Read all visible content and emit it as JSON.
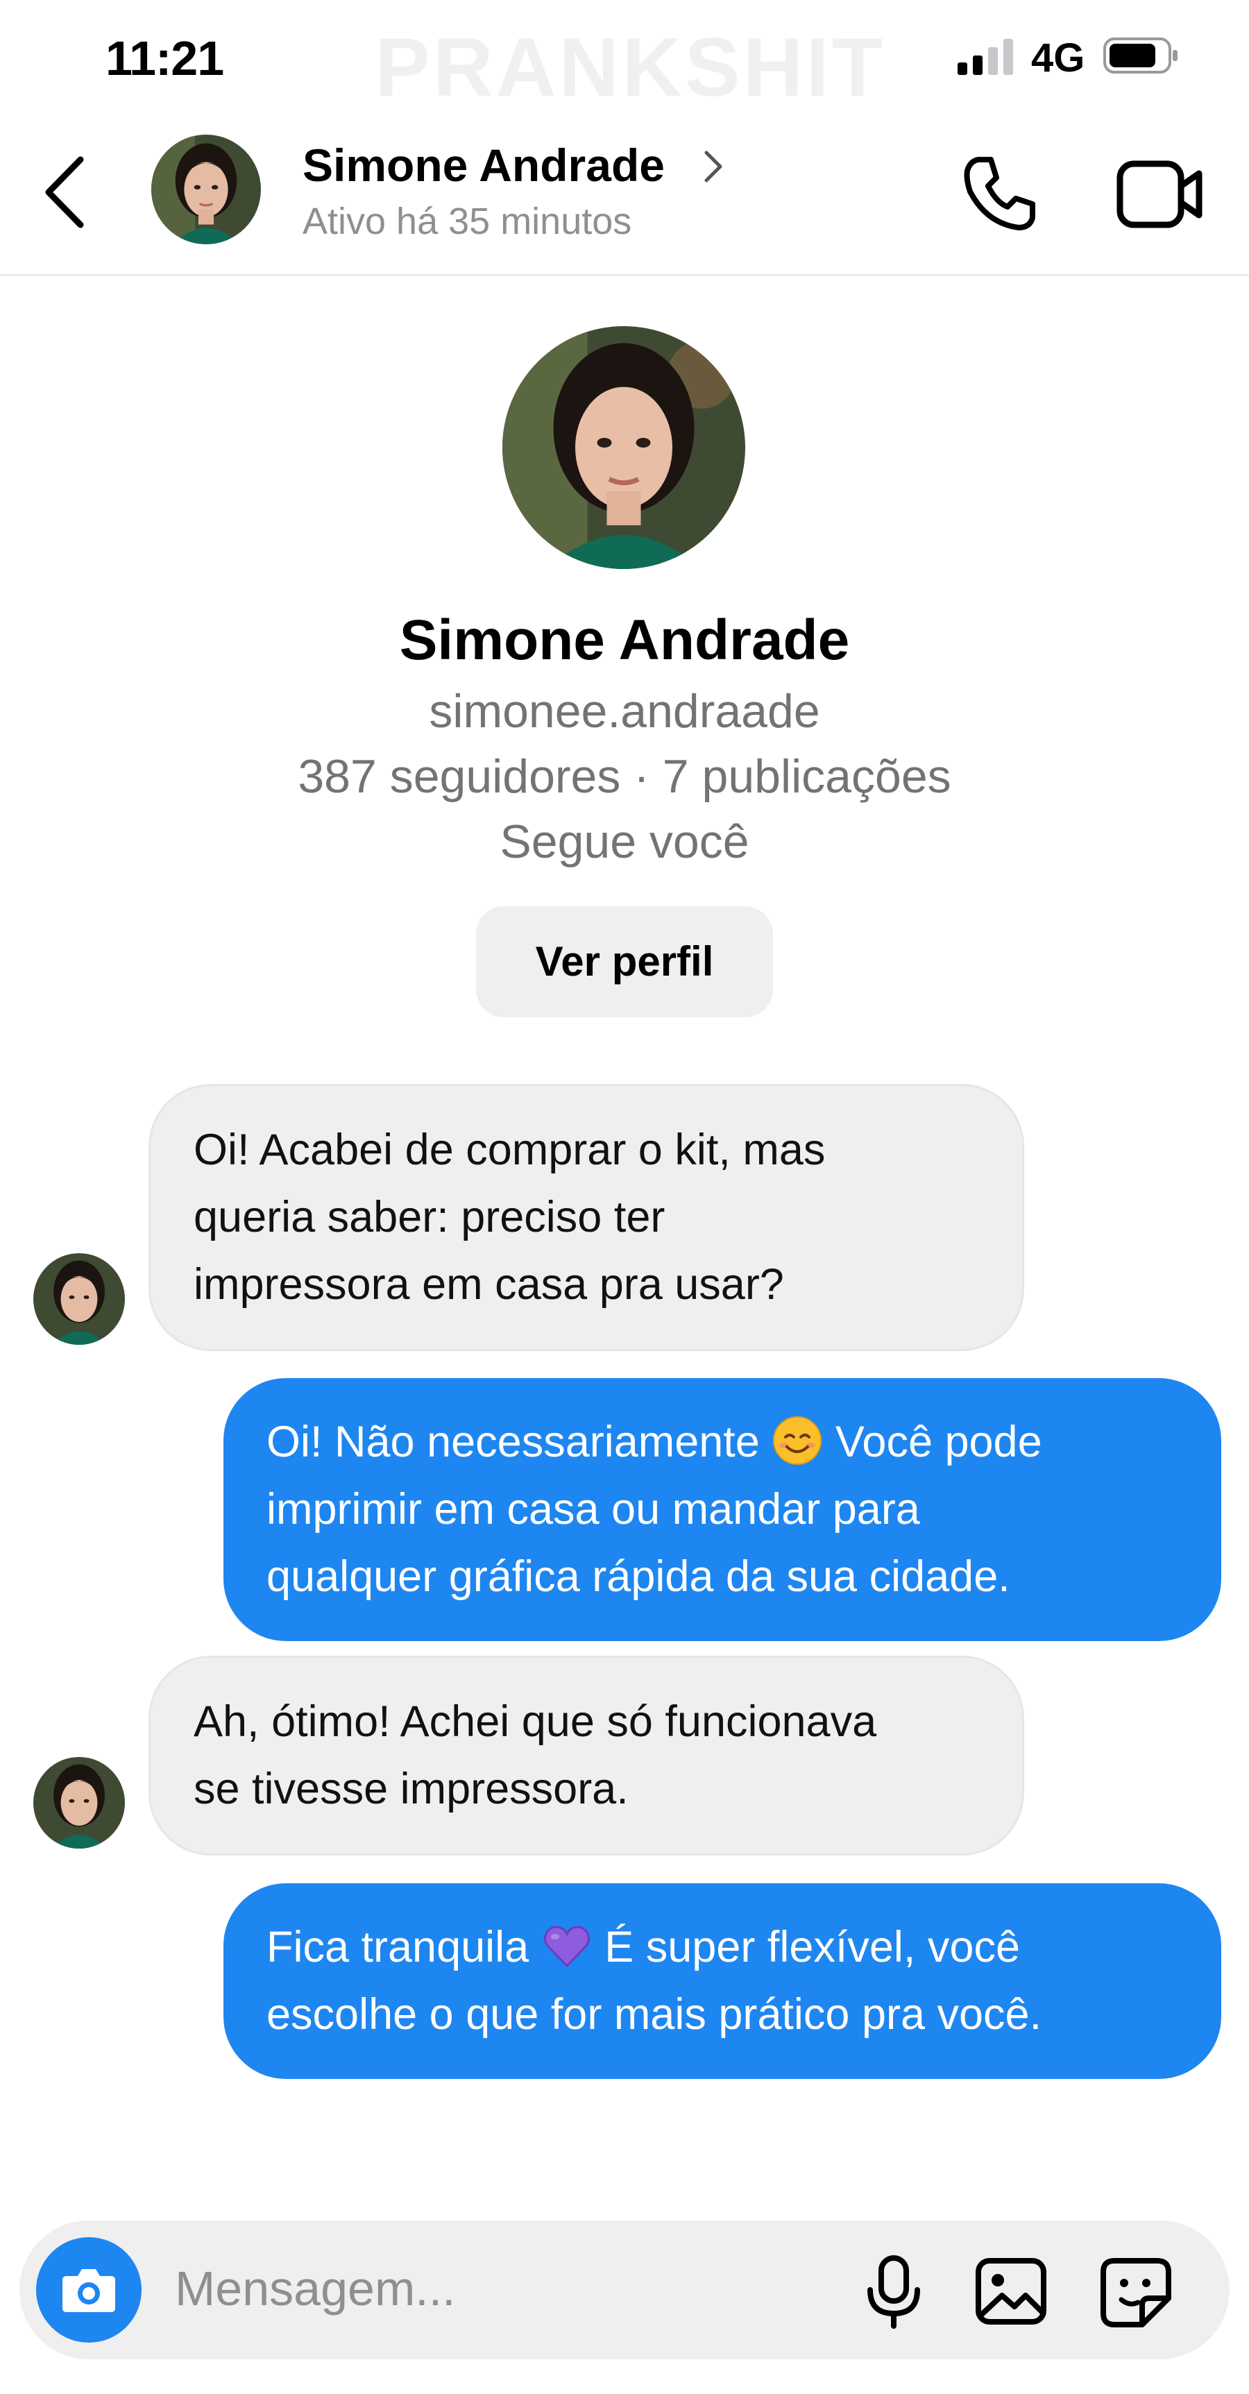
{
  "status": {
    "time": "11:21",
    "network": "4G",
    "watermark": "PRANKSHIT"
  },
  "header": {
    "name": "Simone Andrade",
    "status": "Ativo há 35 minutos"
  },
  "profile": {
    "name": "Simone Andrade",
    "handle": "simonee.andraade",
    "stats": "387 seguidores · 7 publicações",
    "follows_you": "Segue você",
    "button": "Ver perfil"
  },
  "messages": [
    {
      "direction": "incoming",
      "lines": [
        "Oi! Acabei de comprar o kit, mas",
        "queria saber: preciso ter",
        "impressora em casa pra usar?"
      ]
    },
    {
      "direction": "outgoing",
      "line1_before": "Oi! Não necessariamente ",
      "emoji": "smiling-face",
      "line1_after": " Você pode",
      "lines": [
        "imprimir em casa ou mandar para",
        "qualquer gráfica rápida da sua cidade."
      ]
    },
    {
      "direction": "incoming",
      "lines": [
        "Ah, ótimo! Achei que só funcionava",
        "se tivesse impressora."
      ]
    },
    {
      "direction": "outgoing",
      "line1_before": "Fica tranquila ",
      "emoji": "purple-heart",
      "line1_after": " É super flexível, você",
      "lines": [
        "escolhe o que for mais prático pra você."
      ]
    }
  ],
  "composer": {
    "placeholder": "Mensagem..."
  },
  "icons": [
    "back-chevron-icon",
    "chevron-right-icon",
    "phone-icon",
    "video-camera-icon",
    "camera-icon",
    "microphone-icon",
    "gallery-icon",
    "sticker-icon"
  ],
  "colors": {
    "accent": "#1e86f0",
    "incoming_bubble": "#efefef",
    "secondary_text": "#737373"
  }
}
